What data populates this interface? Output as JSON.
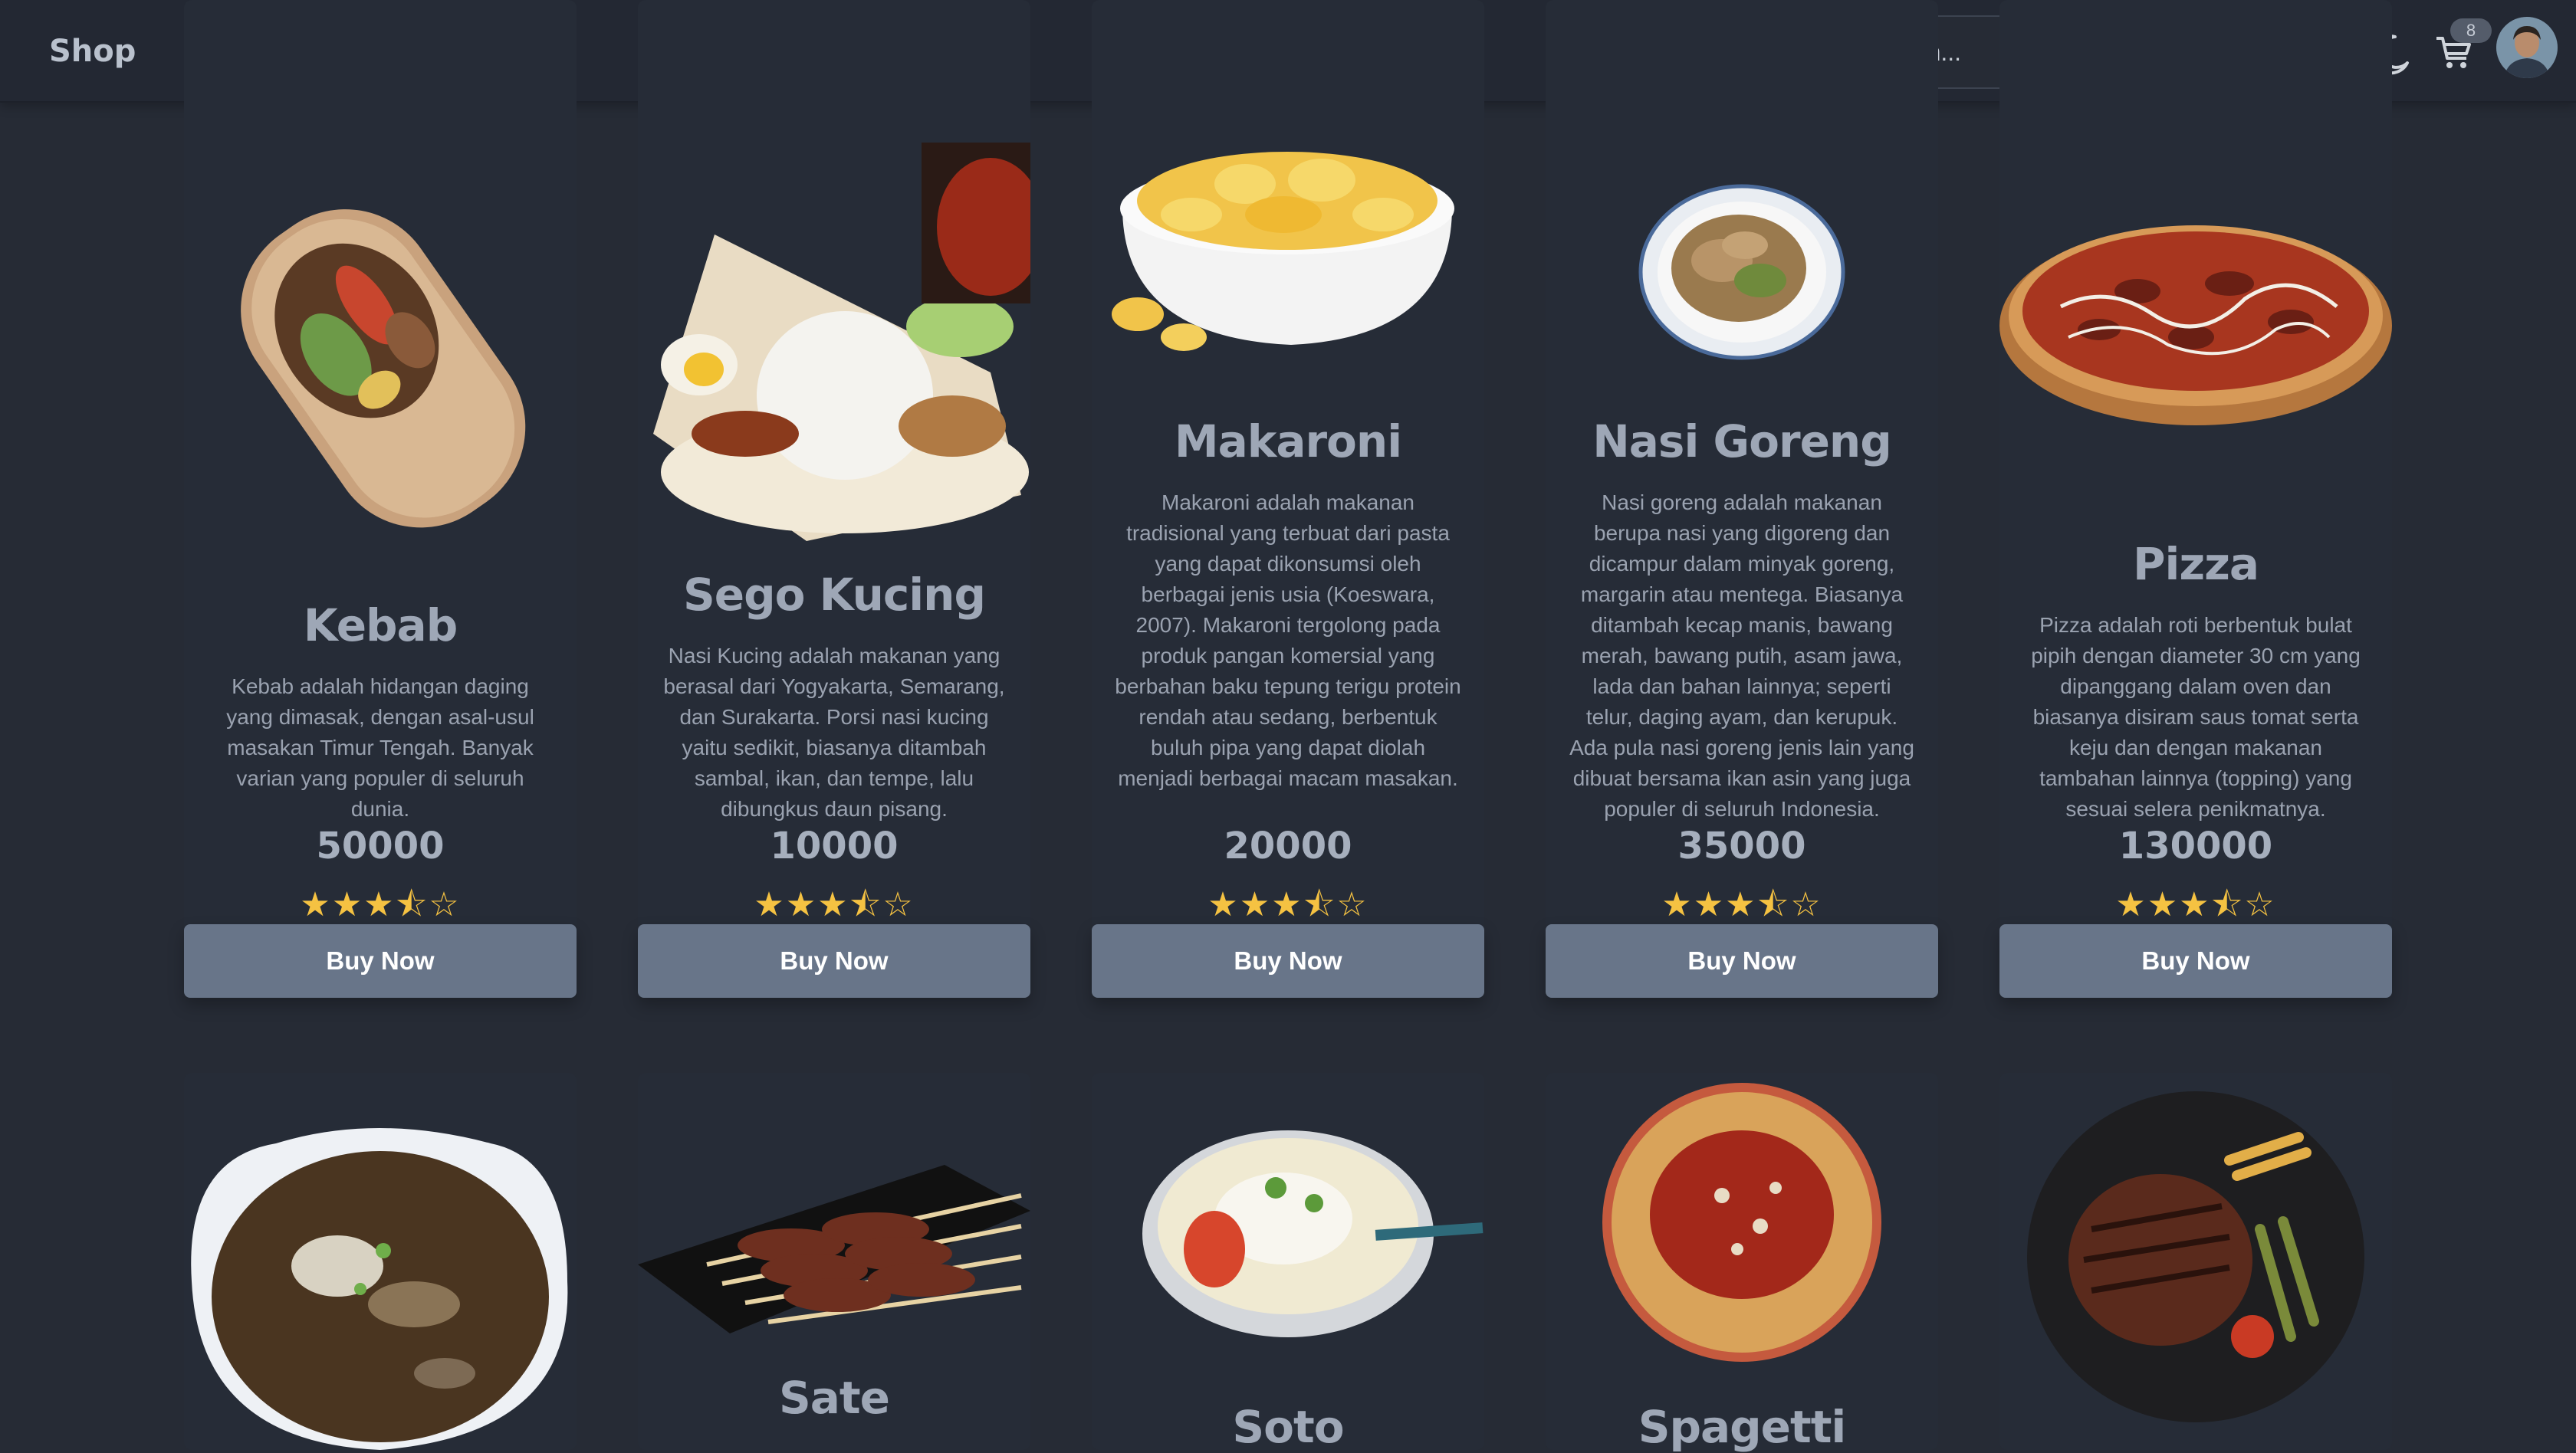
{
  "navbar": {
    "brand": "Shop",
    "search_placeholder": "Search...",
    "cart_count": "8"
  },
  "products": [
    {
      "name": "Kebab",
      "description": "Kebab adalah hidangan daging yang dimasak, dengan asal-usul masakan Timur Tengah. Banyak varian yang populer di seluruh dunia.",
      "price": "50000",
      "rating": 3.5,
      "stars": "★★★⯪☆",
      "button": "Buy Now"
    },
    {
      "name": "Sego Kucing",
      "description": "Nasi Kucing adalah makanan yang berasal dari Yogyakarta, Semarang, dan Surakarta. Porsi nasi kucing yaitu sedikit, biasanya ditambah sambal, ikan, dan tempe, lalu dibungkus daun pisang.",
      "price": "10000",
      "rating": 3.5,
      "stars": "★★★⯪☆",
      "button": "Buy Now"
    },
    {
      "name": "Makaroni",
      "description": "Makaroni adalah makanan tradisional yang terbuat dari pasta yang dapat dikonsumsi oleh berbagai jenis usia (Koeswara, 2007). Makaroni tergolong pada produk pangan komersial yang berbahan baku tepung terigu protein rendah atau sedang, berbentuk buluh pipa yang dapat diolah menjadi berbagai macam masakan.",
      "price": "20000",
      "rating": 3.5,
      "stars": "★★★⯪☆",
      "button": "Buy Now"
    },
    {
      "name": "Nasi Goreng",
      "description": "Nasi goreng adalah makanan berupa nasi yang digoreng dan dicampur dalam minyak goreng, margarin atau mentega. Biasanya ditambah kecap manis, bawang merah, bawang putih, asam jawa, lada dan bahan lainnya; seperti telur, daging ayam, dan kerupuk. Ada pula nasi goreng jenis lain yang dibuat bersama ikan asin yang juga populer di seluruh Indonesia.",
      "price": "35000",
      "rating": 3.5,
      "stars": "★★★⯪☆",
      "button": "Buy Now"
    },
    {
      "name": "Pizza",
      "description": "Pizza adalah roti berbentuk bulat pipih dengan diameter 30 cm yang dipanggang dalam oven dan biasanya disiram saus tomat serta keju dan dengan makanan tambahan lainnya (topping) yang sesuai selera penikmatnya.",
      "price": "130000",
      "rating": 3.5,
      "stars": "★★★⯪☆",
      "button": "Buy Now"
    }
  ],
  "products_row2": [
    {
      "name": ""
    },
    {
      "name": "Sate"
    },
    {
      "name": "Soto"
    },
    {
      "name": "Spagetti"
    },
    {
      "name": ""
    }
  ]
}
